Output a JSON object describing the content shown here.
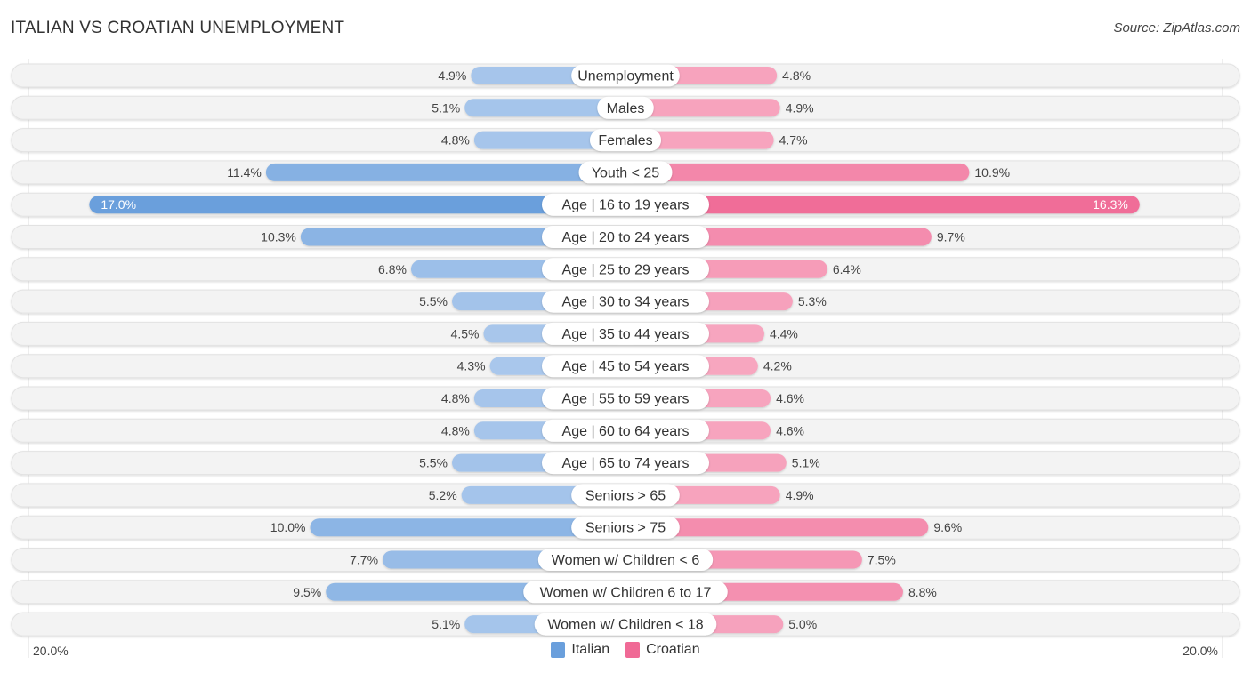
{
  "header": {
    "title": "ITALIAN VS CROATIAN UNEMPLOYMENT",
    "source": "Source: ZipAtlas.com"
  },
  "colors": {
    "italian": "#6a9fdc",
    "croatian": "#f06a96",
    "italian_light": "#aac8ec",
    "croatian_light": "#f7a7c0",
    "row_bg": "#f3f3f3"
  },
  "chart_data": {
    "type": "bar",
    "orientation": "diverging-horizontal",
    "title": "ITALIAN VS CROATIAN UNEMPLOYMENT",
    "xlabel": "",
    "ylabel": "",
    "xlim": [
      -20,
      20
    ],
    "axis_labels": {
      "left": "20.0%",
      "right": "20.0%"
    },
    "legend": {
      "position": "bottom-center",
      "entries": [
        "Italian",
        "Croatian"
      ]
    },
    "categories": [
      "Unemployment",
      "Males",
      "Females",
      "Youth < 25",
      "Age | 16 to 19 years",
      "Age | 20 to 24 years",
      "Age | 25 to 29 years",
      "Age | 30 to 34 years",
      "Age | 35 to 44 years",
      "Age | 45 to 54 years",
      "Age | 55 to 59 years",
      "Age | 60 to 64 years",
      "Age | 65 to 74 years",
      "Seniors > 65",
      "Seniors > 75",
      "Women w/ Children < 6",
      "Women w/ Children 6 to 17",
      "Women w/ Children < 18"
    ],
    "series": [
      {
        "name": "Italian",
        "side": "left",
        "values": [
          4.9,
          5.1,
          4.8,
          11.4,
          17.0,
          10.3,
          6.8,
          5.5,
          4.5,
          4.3,
          4.8,
          4.8,
          5.5,
          5.2,
          10.0,
          7.7,
          9.5,
          5.1
        ],
        "labels": [
          "4.9%",
          "5.1%",
          "4.8%",
          "11.4%",
          "17.0%",
          "10.3%",
          "6.8%",
          "5.5%",
          "4.5%",
          "4.3%",
          "4.8%",
          "4.8%",
          "5.5%",
          "5.2%",
          "10.0%",
          "7.7%",
          "9.5%",
          "5.1%"
        ]
      },
      {
        "name": "Croatian",
        "side": "right",
        "values": [
          4.8,
          4.9,
          4.7,
          10.9,
          16.3,
          9.7,
          6.4,
          5.3,
          4.4,
          4.2,
          4.6,
          4.6,
          5.1,
          4.9,
          9.6,
          7.5,
          8.8,
          5.0
        ],
        "labels": [
          "4.8%",
          "4.9%",
          "4.7%",
          "10.9%",
          "16.3%",
          "9.7%",
          "6.4%",
          "5.3%",
          "4.4%",
          "4.2%",
          "4.6%",
          "4.6%",
          "5.1%",
          "4.9%",
          "9.6%",
          "7.5%",
          "8.8%",
          "5.0%"
        ]
      }
    ]
  }
}
